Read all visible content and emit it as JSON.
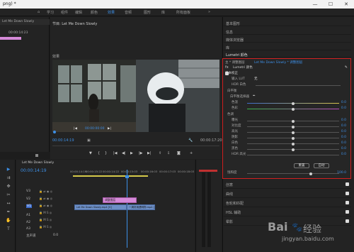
{
  "window": {
    "title": "png) *",
    "min": "—",
    "max": "☐",
    "close": "✕"
  },
  "menu": {
    "items": [
      "学习",
      "组件",
      "编辑",
      "颜色",
      "效果",
      "音频",
      "图形",
      "库",
      "所有面板"
    ],
    "active_index": 4,
    "more": "»"
  },
  "source": {
    "sequence_tab": "Let Me Down Slowly",
    "timecode": "00:00:14:23"
  },
  "program": {
    "title": "节目: Let Me Down Slowly",
    "label_left": "效果",
    "tc_current": "00:00:14:19",
    "tc_total": "00:00:17:20",
    "inner_tc": "00:00:00:00"
  },
  "timeline": {
    "tab": "Let Me Down Slowly",
    "timecode": "00:00:14:19",
    "ruler": [
      "00:00:14:19",
      "00:00:15:22",
      "00:00:14:22",
      "00:00:15:03",
      "00:00:16:03",
      "00:00:17:03",
      "00:00:18:03"
    ],
    "tracks": [
      "V3",
      "V2",
      "V1",
      "A1",
      "A2",
      "A3",
      "主声道"
    ],
    "clips": [
      {
        "label": "调整图层",
        "track": "V2"
      },
      {
        "label": "Let Me Down Slowly.mp4 [V]",
        "track": "V1"
      },
      {
        "label": "一滴好用透明物.mp4 [V]",
        "track": "V1"
      }
    ],
    "master_value": "0.0"
  },
  "right_panel": {
    "top_items": [
      "基本图形",
      "信息",
      "媒体浏览器",
      "库"
    ],
    "lumetri": {
      "tab": "Lumetri 颜色",
      "crumb_left": "主 * 调整图层",
      "crumb_right": "Let Me Down Slowly * 调整图层",
      "fx_label": "fx",
      "section": "Lumetri 颜色",
      "basic": "基本校正",
      "input_lut": "输入 LUT",
      "input_lut_value": "无",
      "hdr": "HDR 白色",
      "white_balance": "白平衡",
      "wb_selector": "白平衡选择器",
      "temp": "色温",
      "temp_val": "0.0",
      "tint": "色彩",
      "tint_val": "0.0",
      "tone": "色调",
      "exposure": "曝光",
      "exposure_val": "0.0",
      "contrast": "对比度",
      "contrast_val": "0.0",
      "highlights": "高光",
      "highlights_val": "0.0",
      "shadows": "阴影",
      "shadows_val": "0.0",
      "whites": "白色",
      "whites_val": "0.0",
      "blacks": "黑色",
      "blacks_val": "0.0",
      "hdr_spec": "HDR 高光",
      "hdr_spec_val": "0.0",
      "reset": "重置",
      "auto": "自动",
      "saturation": "饱和度",
      "saturation_val": "100.0"
    },
    "bottom_items": [
      "创意",
      "曲线",
      "色轮和匹配",
      "HSL 辅助",
      "晕影"
    ]
  },
  "watermark": {
    "brand": "Bai",
    "brand2": "经验",
    "url": "jingyan.baidu.com"
  },
  "colors": {
    "accent": "#3d8fe6",
    "highlight_box": "#d02020",
    "clip_pink": "#d58ad8",
    "clip_blue": "#6d8fc6",
    "playhead": "#3d8fe6"
  }
}
